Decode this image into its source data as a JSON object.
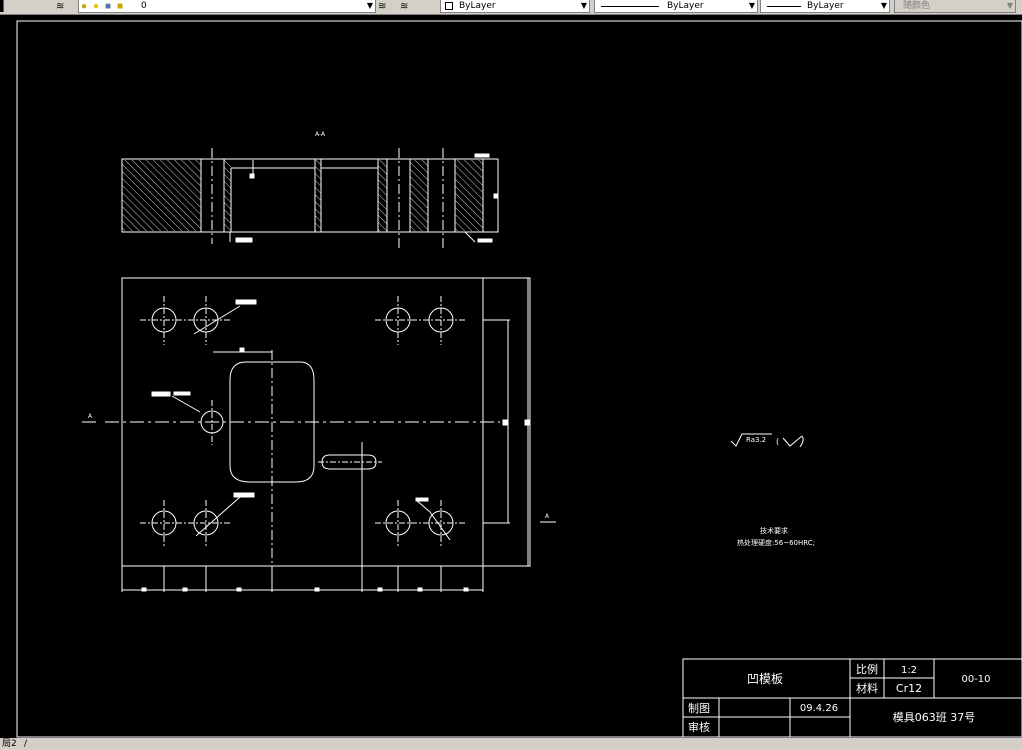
{
  "toolbar": {
    "layer_value": "0",
    "color_value": "ByLayer",
    "linetype_value": "ByLayer",
    "lineweight_value": "ByLayer",
    "plotstyle_value": "随颜色"
  },
  "drawing": {
    "section_label": "A-A",
    "roughness_symbol": "Ra3.2",
    "roughness_suffix": "(",
    "tech_title": "技术要求",
    "tech_text": "热处理硬度:56~60HRC;",
    "section_marker_left": "A",
    "section_marker_right": "A"
  },
  "title_block": {
    "part_name": "凹模板",
    "scale_label": "比例",
    "scale_value": "1:2",
    "drawing_no": "00-10",
    "material_label": "材料",
    "material_value": "Cr12",
    "drawn_label": "制图",
    "date": "09.4.26",
    "class_info": "模具063班   37号",
    "review_label": "审核"
  },
  "status": {
    "layout_tab": "局2"
  }
}
